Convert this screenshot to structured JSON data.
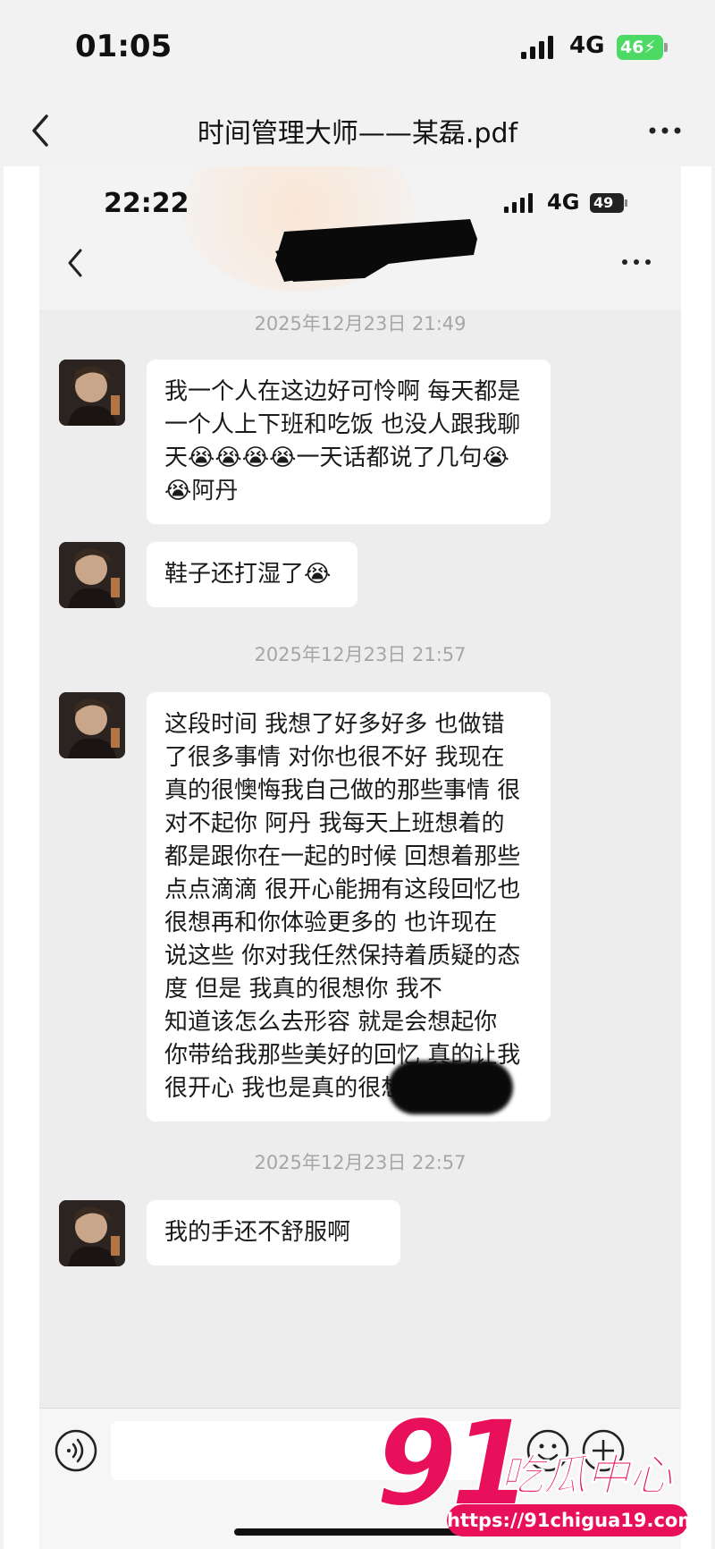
{
  "outer_status": {
    "time": "01:05",
    "network": "4G",
    "battery": "46"
  },
  "outer_nav": {
    "title": "时间管理大师——某磊.pdf"
  },
  "inner_status": {
    "time": "22:22",
    "network": "4G",
    "battery": "49"
  },
  "chat": {
    "timestamps": [
      "2025年12月23日 21:49",
      "2025年12月23日 21:57",
      "2025年12月23日 22:57"
    ],
    "messages": [
      {
        "lines": [
          "我一个人在这边好可怜啊 每天都是",
          "一个人上下班和吃饭 也没人跟我聊",
          "天😭😭😭😭一天话都说了几句😭",
          "😭阿丹"
        ]
      },
      {
        "lines": [
          "鞋子还打湿了😭"
        ]
      },
      {
        "lines": [
          "这段时间 我想了好多好多 也做错",
          "了很多事情 对你也很不好 我现在",
          "真的很懊悔我自己做的那些事情 很",
          "对不起你 阿丹 我每天上班想着的",
          "都是跟你在一起的时候 回想着那些",
          "点点滴滴 很开心能拥有这段回忆也",
          "很想再和你体验更多的 也许现在",
          "说这些 你对我任然保持着质疑的态",
          "度 但是 我真的很想你        我不",
          "知道该怎么去形容 就是会想起你",
          "你带给我那些美好的回忆 真的让我",
          "很开心 我也是真的很想你"
        ]
      },
      {
        "lines": [
          "我的手还不舒服啊"
        ]
      }
    ]
  },
  "watermark": {
    "number": "91",
    "name": "吃瓜中心",
    "url": "https://91chigua19.com",
    "color": "#e8105a"
  },
  "icons": [
    "back-icon",
    "more-icon",
    "signal-icon",
    "battery-icon",
    "voice-icon",
    "emoji-icon",
    "plus-icon",
    "crying-emoji-icon"
  ]
}
